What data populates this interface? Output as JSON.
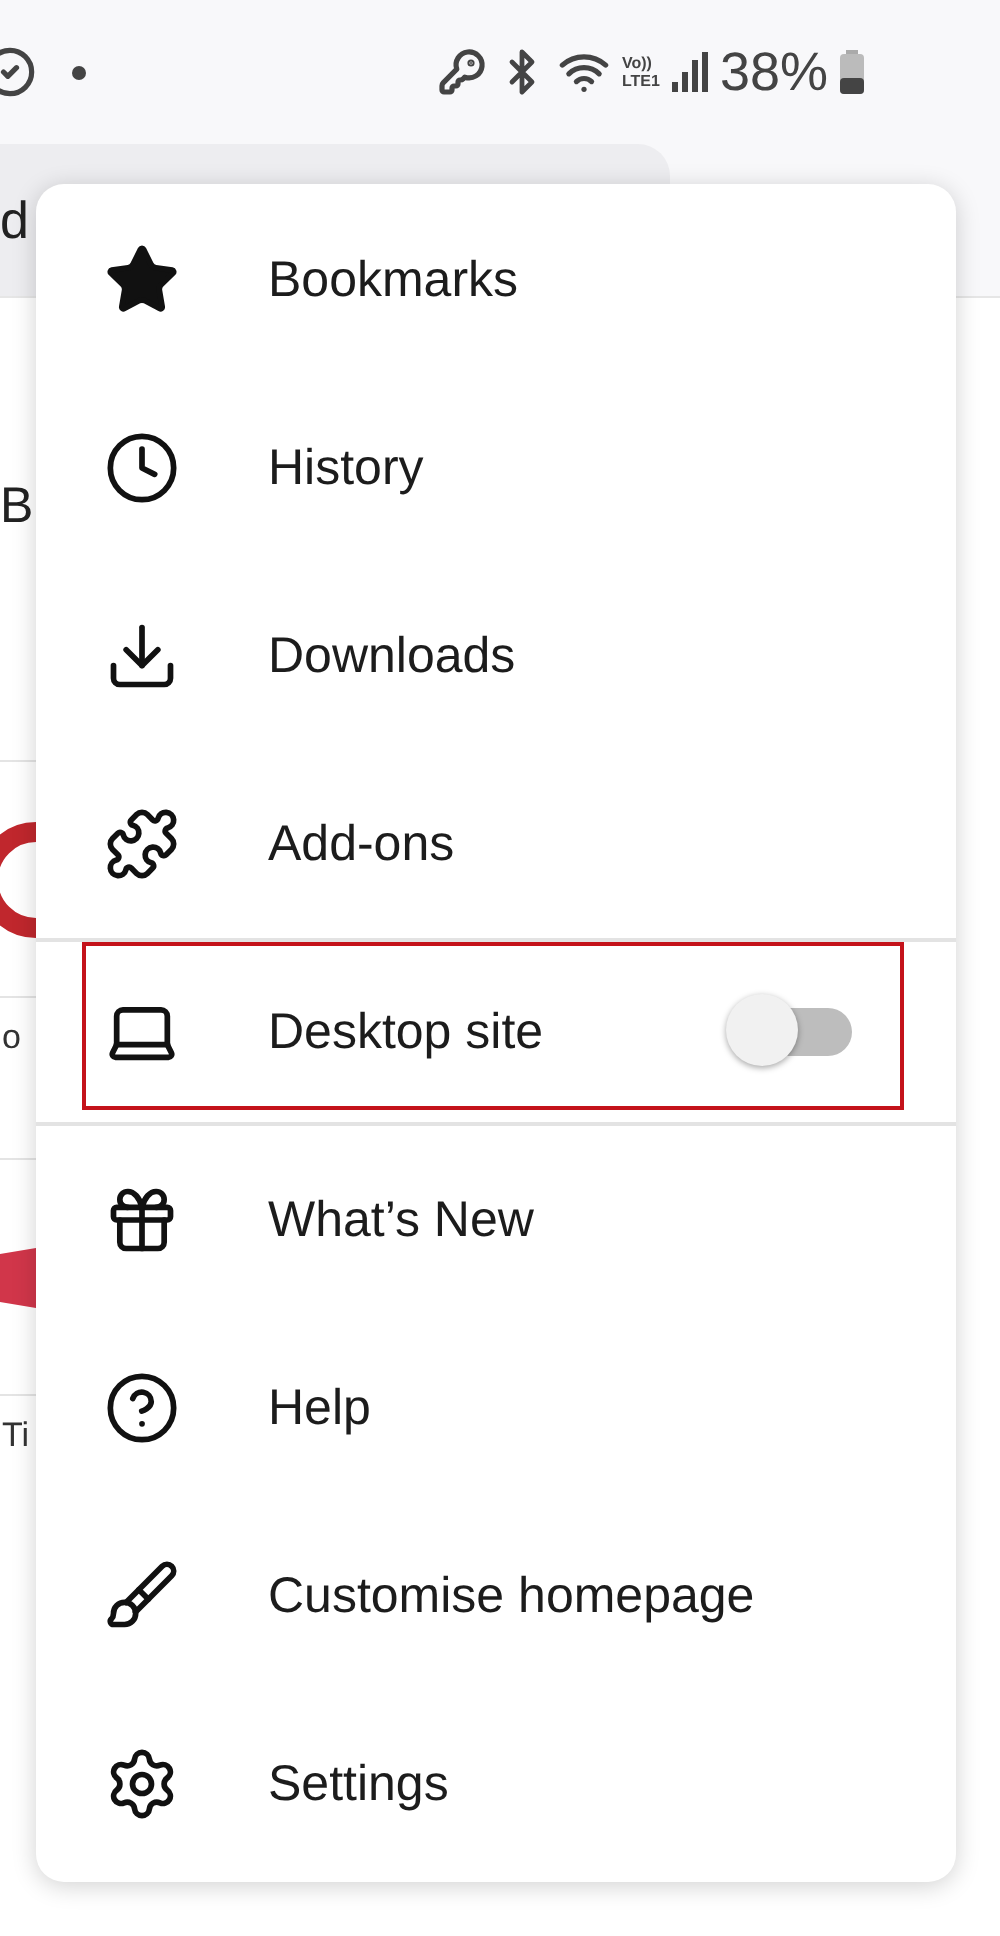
{
  "status_bar": {
    "battery": "38%",
    "network_top": "Vo))",
    "network_bottom": "LTE1"
  },
  "background_page": {
    "address_fragment": "d",
    "heading_fragment": "B",
    "card_labels": [
      "o",
      "Ti"
    ]
  },
  "menu": {
    "items": [
      {
        "kind": "link",
        "label": "Bookmarks"
      },
      {
        "kind": "link",
        "label": "History"
      },
      {
        "kind": "link",
        "label": "Downloads"
      },
      {
        "kind": "link",
        "label": "Add-ons"
      },
      {
        "kind": "toggle",
        "label": "Desktop site",
        "on": false,
        "highlighted": true
      },
      {
        "kind": "link",
        "label": "What’s New"
      },
      {
        "kind": "link",
        "label": "Help"
      },
      {
        "kind": "link",
        "label": "Customise homepage"
      },
      {
        "kind": "link",
        "label": "Settings"
      }
    ]
  }
}
